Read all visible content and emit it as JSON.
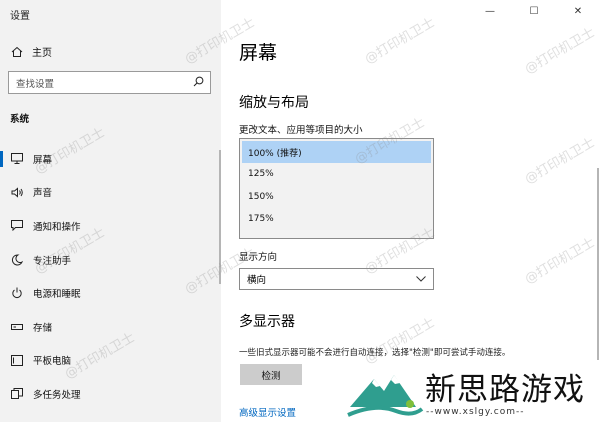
{
  "window": {
    "title": "设置",
    "controls": [
      "minimize",
      "maximize",
      "close"
    ]
  },
  "sidebar": {
    "home_label": "主页",
    "search_placeholder": "查找设置",
    "section_title": "系统",
    "items": [
      {
        "label": "屏幕",
        "icon": "monitor-icon",
        "active": true
      },
      {
        "label": "声音",
        "icon": "speaker-icon"
      },
      {
        "label": "通知和操作",
        "icon": "notification-icon"
      },
      {
        "label": "专注助手",
        "icon": "moon-icon"
      },
      {
        "label": "电源和睡眠",
        "icon": "power-icon"
      },
      {
        "label": "存储",
        "icon": "storage-icon"
      },
      {
        "label": "平板电脑",
        "icon": "tablet-icon"
      },
      {
        "label": "多任务处理",
        "icon": "multitask-icon"
      }
    ]
  },
  "main": {
    "page_title": "屏幕",
    "scale_section": "缩放与布局",
    "scale_label": "更改文本、应用等项目的大小",
    "scale_options": [
      "100% (推荐)",
      "125%",
      "150%",
      "175%"
    ],
    "scale_selected": "100% (推荐)",
    "orientation_label": "显示方向",
    "orientation_value": "横向",
    "multi_display_title": "多显示器",
    "multi_display_desc": "一些旧式显示器可能不会进行自动连接，选择\"检测\"即可尝试手动连接。",
    "detect_button": "检测",
    "advanced_link": "高级显示设置"
  },
  "watermark": {
    "text": "@打印机卫士"
  },
  "overlay_logo": {
    "name": "新思路游戏",
    "url": "--www.xslgy.com--"
  }
}
